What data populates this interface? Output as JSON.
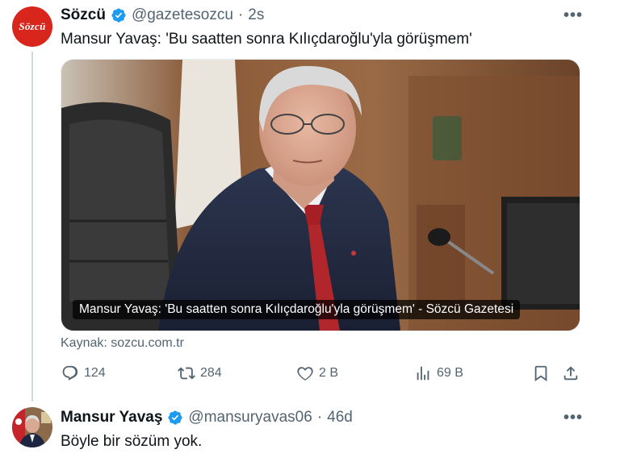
{
  "tweet1": {
    "author_name": "Sözcü",
    "handle": "@gazetesozcu",
    "time": "2s",
    "text": "Mansur Yavaş: 'Bu saatten sonra Kılıçdaroğlu'yla görüşmem'",
    "avatar_text": "Sözcü",
    "card_caption": "Mansur Yavaş: 'Bu saatten sonra Kılıçdaroğlu'yla görüşmem' - Sözcü Gazetesi",
    "source": "Kaynak: sozcu.com.tr",
    "actions": {
      "replies": "124",
      "retweets": "284",
      "likes": "2 B",
      "views": "69 B"
    }
  },
  "tweet2": {
    "author_name": "Mansur Yavaş",
    "handle": "@mansuryavas06",
    "time": "46d",
    "text": "Böyle bir sözüm yok."
  },
  "separator": "·",
  "more_glyph": "•••",
  "colors": {
    "brand_red": "#d9261c",
    "verified_blue": "#1d9bf0",
    "muted": "#536471",
    "thread_line": "#cfd9de"
  },
  "icons": [
    "verified-badge-icon",
    "more-icon",
    "reply-icon",
    "retweet-icon",
    "like-icon",
    "views-icon",
    "bookmark-icon",
    "share-icon"
  ]
}
